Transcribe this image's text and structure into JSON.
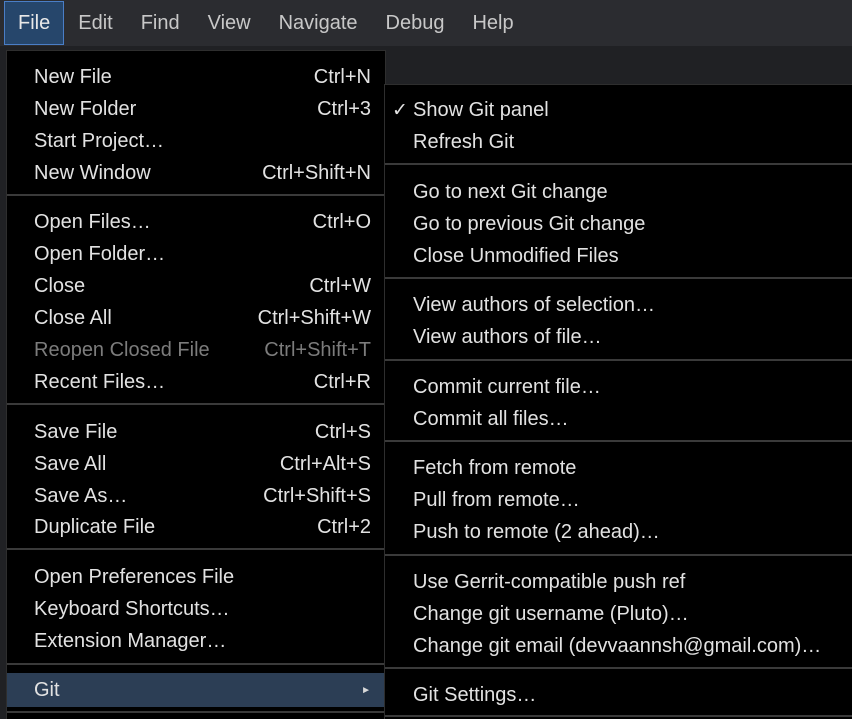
{
  "menubar": {
    "items": [
      "File",
      "Edit",
      "Find",
      "View",
      "Navigate",
      "Debug",
      "Help"
    ],
    "active": "File"
  },
  "file_menu": {
    "items": [
      {
        "label": "New File",
        "shortcut": "Ctrl+N"
      },
      {
        "label": "New Folder",
        "shortcut": "Ctrl+3"
      },
      {
        "label": "Start Project…",
        "shortcut": ""
      },
      {
        "label": "New Window",
        "shortcut": "Ctrl+Shift+N"
      },
      {
        "label": "Open Files…",
        "shortcut": "Ctrl+O"
      },
      {
        "label": "Open Folder…",
        "shortcut": ""
      },
      {
        "label": "Close",
        "shortcut": "Ctrl+W"
      },
      {
        "label": "Close All",
        "shortcut": "Ctrl+Shift+W"
      },
      {
        "label": "Reopen Closed File",
        "shortcut": "Ctrl+Shift+T",
        "disabled": true
      },
      {
        "label": "Recent Files…",
        "shortcut": "Ctrl+R"
      },
      {
        "label": "Save File",
        "shortcut": "Ctrl+S"
      },
      {
        "label": "Save All",
        "shortcut": "Ctrl+Alt+S"
      },
      {
        "label": "Save As…",
        "shortcut": "Ctrl+Shift+S"
      },
      {
        "label": "Duplicate File",
        "shortcut": "Ctrl+2"
      },
      {
        "label": "Open Preferences File",
        "shortcut": ""
      },
      {
        "label": "Keyboard Shortcuts…",
        "shortcut": ""
      },
      {
        "label": "Extension Manager…",
        "shortcut": ""
      },
      {
        "label": "Git",
        "shortcut": "",
        "submenu": true,
        "highlighted": true
      }
    ]
  },
  "git_menu": {
    "check_mark": "✓",
    "items": [
      {
        "label": "Show Git panel",
        "checked": true
      },
      {
        "label": "Refresh Git"
      },
      {
        "label": "Go to next Git change"
      },
      {
        "label": "Go to previous Git change"
      },
      {
        "label": "Close Unmodified Files"
      },
      {
        "label": "View authors of selection…"
      },
      {
        "label": "View authors of file…"
      },
      {
        "label": "Commit current file…"
      },
      {
        "label": "Commit all files…"
      },
      {
        "label": "Fetch from remote"
      },
      {
        "label": "Pull from remote…"
      },
      {
        "label": "Push to remote (2 ahead)…"
      },
      {
        "label": "Use Gerrit-compatible push ref"
      },
      {
        "label": "Change git username (Pluto)…"
      },
      {
        "label": "Change git email (devvaannsh@gmail.com)…"
      },
      {
        "label": "Git Settings…"
      }
    ]
  },
  "colors": {
    "menubar_bg": "#2b2c30",
    "menu_bg": "#000000",
    "active_title_bg": "#26466b",
    "highlight_bg": "#2c3e55",
    "text": "#e2e2e2",
    "disabled_text": "#7c7c7c"
  }
}
